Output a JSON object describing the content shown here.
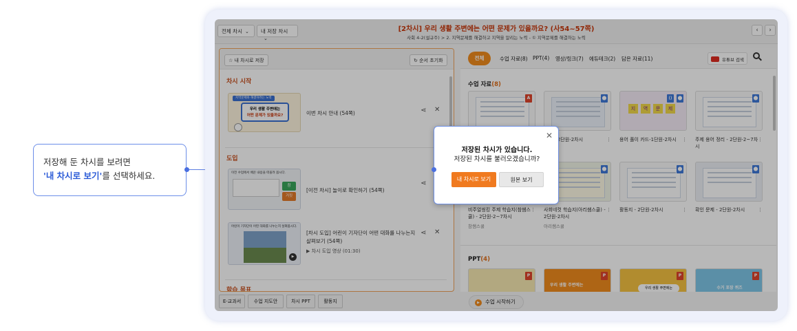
{
  "callout": {
    "line1": "저장해 둔 차시를 보려면",
    "highlight": "'내 차시로 보기'",
    "line2_rest": "를 선택하세요."
  },
  "topbar": {
    "select_all": "전체 차시",
    "select_saved": "내 저장 차시",
    "title": "[2차시] 우리 생활 주변에는 어떤 문제가 있을까요? (사54~57쪽)",
    "subtitle": "사회 4-2(설규주) > 2. 지역문제를 해결하고 지역을 알리는 노력 - ① 지역문제를 해결하는 노력"
  },
  "left_panel": {
    "save_button": "내 차시로 저장",
    "reset_button": "순서 초기화",
    "sections": {
      "start": "차시 시작",
      "intro": "도입",
      "goal": "학습 목표"
    },
    "items": [
      {
        "label": "이번 차시 안내 (54쪽)"
      },
      {
        "label": "[이전 차시] 놀이로 확인하기 (54쪽)"
      },
      {
        "label": "[차시 도입] 어린이 기자단이 어떤 대화를 나누는지 살펴보기 (54쪽)",
        "sub": "차시 도입 영상 (01:30)"
      }
    ],
    "thumb1": {
      "tag": "지역문제와 해결하려는 노력",
      "line1": "우리 생활 주변에는",
      "line2": "어떤 문제가 있을까요?"
    },
    "thumb2": {
      "header": "이전 수업에서 배운 내용을 떠올려 봅시다.",
      "true_label": "참",
      "false_label": "거짓"
    },
    "thumb3": {
      "header": "어린이 기자단이 어떤 대화를 나누는지 살펴봅시다."
    }
  },
  "bottom_tabs": [
    "E-교과서",
    "수업 지도안",
    "차시 PPT",
    "활동지"
  ],
  "right_panel": {
    "tabs": {
      "all": "전체",
      "materials": "수업 자료(8)",
      "ppt": "PPT(4)",
      "video": "영상/링크(7)",
      "edutech": "에듀테크(2)",
      "saved": "담은 자료(11)"
    },
    "youtube_search": "유튜브 검색",
    "section_materials": "수업 자료",
    "section_materials_count": "(8)",
    "section_ppt": "PPT",
    "section_ppt_count": "(4)",
    "cards_row1": [
      {
        "label": "",
        "sub": ""
      },
      {
        "label": "도안 - 2단원-2차시",
        "sub": ""
      },
      {
        "label": "용어 풀이 카드-1단원-2차시",
        "sub": ""
      },
      {
        "label": "주제 용어 정리 - 2단원-2~7차시",
        "sub": ""
      }
    ],
    "cards_row2": [
      {
        "label": "비주얼씽킹 주제 학습지(참쌤스쿨) - 2단원-2~7차시",
        "sub": "참쌤스쿨"
      },
      {
        "label": "사회네컷 학습지(아리쌤스쿨) - 2단원-2차시",
        "sub": "아리쌤스쿨"
      },
      {
        "label": "활동지 - 2단원-2차시",
        "sub": ""
      },
      {
        "label": "확인 문제 - 2단원-2차시",
        "sub": ""
      }
    ],
    "thumb_words": [
      "지",
      "역",
      "문",
      "제"
    ],
    "ppt_thumb_text": "우리 생활 주변에는",
    "ppt_thumb_text2": "수거 포장 퀴즈",
    "start_class": "수업 시작하기"
  },
  "modal": {
    "title": "저장된 차시가 있습니다.",
    "question": "저장된 차시를 불러오겠습니까?",
    "primary": "내 차시로 보기",
    "secondary": "원본 보기"
  },
  "colors": {
    "accent": "#f07a1f",
    "link_blue": "#2b5bd7",
    "title_red": "#c8360a"
  }
}
